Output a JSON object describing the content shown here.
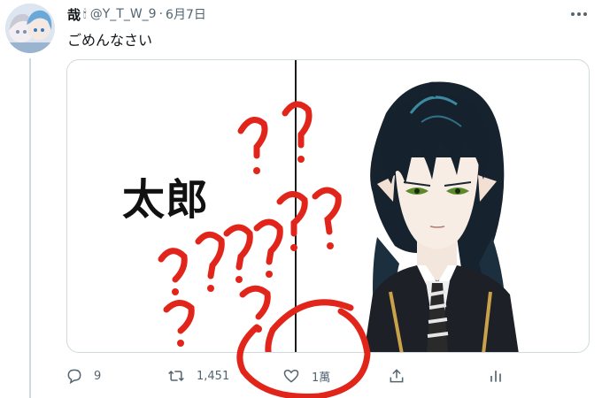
{
  "tweet": {
    "author_name": "哉",
    "author_emoji": "🕯",
    "handle": "@Y_T_W_9",
    "separator": "·",
    "date": "6月7日",
    "text": "ごめんなさい"
  },
  "media": {
    "overlay_text": "太郎"
  },
  "actions": {
    "reply_count": "9",
    "retweet_count": "1,451",
    "like_count": "1萬"
  },
  "colors": {
    "annotation_red": "#e1251b",
    "muted_text": "#536471",
    "border": "#cfd9de"
  }
}
